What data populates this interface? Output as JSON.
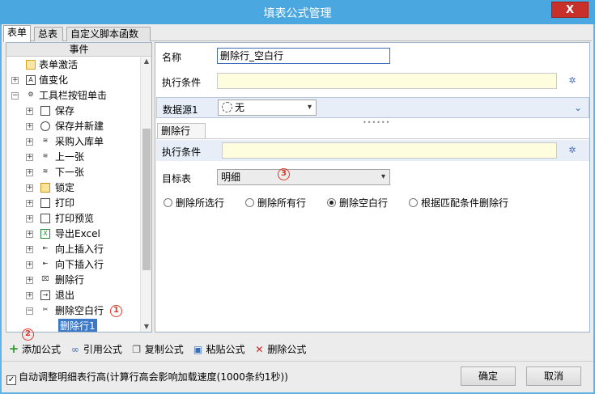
{
  "window": {
    "title": "填表公式管理",
    "close_label": "X"
  },
  "tabs": [
    "表单",
    "总表",
    "自定义脚本函数"
  ],
  "left": {
    "header": "事件",
    "tree": [
      {
        "label": "表单激活",
        "icon": "folder-icon"
      },
      {
        "label": "值变化",
        "icon": "document-a-icon"
      },
      {
        "label": "工具栏按钮单击",
        "icon": "wrench-icon"
      },
      {
        "label": "保存",
        "icon": "save-icon"
      },
      {
        "label": "保存并新建",
        "icon": "save-new-icon"
      },
      {
        "label": "采购入库单",
        "icon": "layers-icon"
      },
      {
        "label": "上一张",
        "icon": "layers-icon"
      },
      {
        "label": "下一张",
        "icon": "layers-icon"
      },
      {
        "label": "锁定",
        "icon": "lock-icon"
      },
      {
        "label": "打印",
        "icon": "printer-icon"
      },
      {
        "label": "打印预览",
        "icon": "print-preview-icon"
      },
      {
        "label": "导出Excel",
        "icon": "excel-icon"
      },
      {
        "label": "向上插入行",
        "icon": "insert-row-up-icon"
      },
      {
        "label": "向下插入行",
        "icon": "insert-row-down-icon"
      },
      {
        "label": "删除行",
        "icon": "delete-row-icon"
      },
      {
        "label": "退出",
        "icon": "exit-icon"
      },
      {
        "label": "删除空白行",
        "icon": "scissors-icon"
      },
      {
        "label": "删除行1",
        "icon": ""
      }
    ]
  },
  "right": {
    "name_label": "名称",
    "name_value": "删除行_空白行",
    "cond_label": "执行条件",
    "ds_label": "数据源1",
    "ds_value": "无",
    "subtab": "删除行",
    "cond2_label": "执行条件",
    "target_label": "目标表",
    "target_value": "明细",
    "radios": [
      "删除所选行",
      "删除所有行",
      "删除空白行",
      "根据匹配条件删除行"
    ],
    "radio_selected": 2
  },
  "badges": [
    "1",
    "2",
    "3"
  ],
  "toolbar": [
    {
      "label": "添加公式",
      "icon": "plus-icon",
      "color": "#2e9a2e"
    },
    {
      "label": "引用公式",
      "icon": "link-icon",
      "color": "#3a6fb6"
    },
    {
      "label": "复制公式",
      "icon": "copy-icon",
      "color": "#555555"
    },
    {
      "label": "粘贴公式",
      "icon": "paste-icon",
      "color": "#3a6fb6"
    },
    {
      "label": "删除公式",
      "icon": "delete-x-icon",
      "color": "#d62020"
    }
  ],
  "bottom": {
    "checkbox_label": "自动调整明细表行高(计算行高会影响加载速度(1000条约1秒))",
    "ok": "确定",
    "cancel": "取消"
  },
  "colors": {
    "titlebar": "#4aa7df",
    "close": "#c7312a",
    "condition_bg": "#fefddd",
    "badge": "#e03a2a"
  }
}
